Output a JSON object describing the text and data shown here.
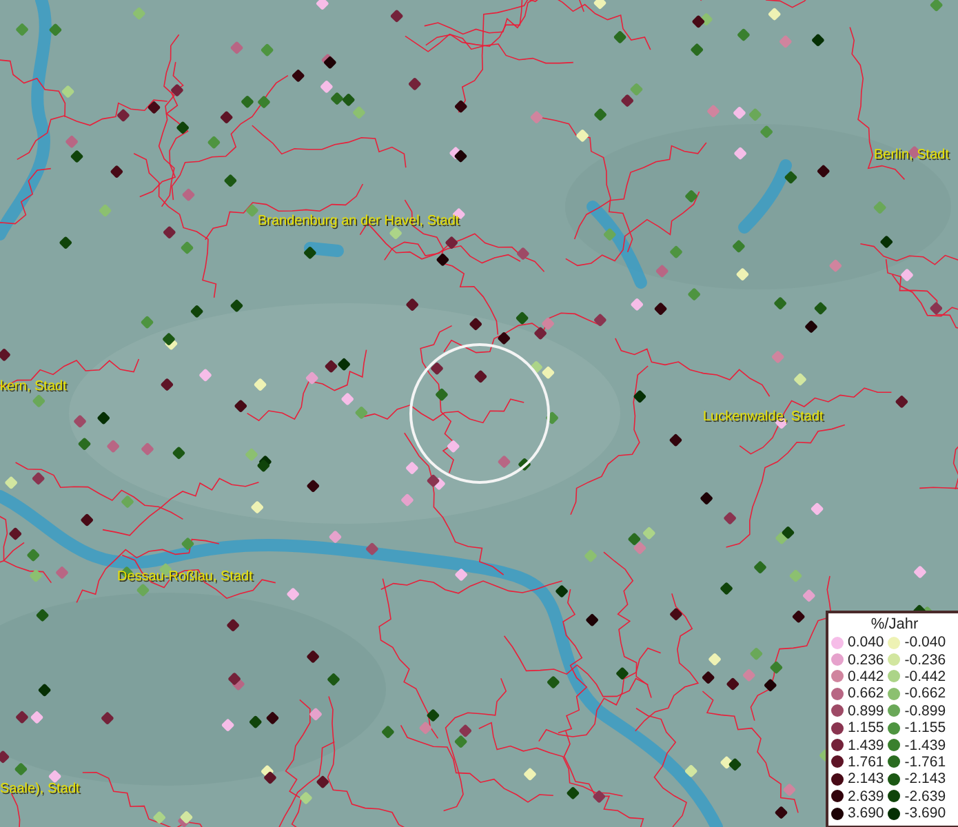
{
  "map": {
    "place_labels": [
      "Berlin, Stadt",
      "Brandenburg an der Havel, Stadt",
      "kern, Stadt",
      "Luckenwalde, Stadt",
      "Dessau-Roßlau, Stadt",
      "Saale), Stadt"
    ]
  },
  "legend": {
    "title": "%/Jahr",
    "positive": [
      {
        "label": "0.040",
        "color": "#f6bde8"
      },
      {
        "label": "0.236",
        "color": "#e6a2cc"
      },
      {
        "label": "0.442",
        "color": "#d0849e"
      },
      {
        "label": "0.662",
        "color": "#b86684"
      },
      {
        "label": "0.899",
        "color": "#9e4a66"
      },
      {
        "label": "1.155",
        "color": "#8a3450"
      },
      {
        "label": "1.439",
        "color": "#74223a"
      },
      {
        "label": "1.761",
        "color": "#5e1426"
      },
      {
        "label": "2.143",
        "color": "#480a16"
      },
      {
        "label": "2.639",
        "color": "#32040c"
      },
      {
        "label": "3.690",
        "color": "#1e0206"
      }
    ],
    "negative": [
      {
        "label": "-0.040",
        "color": "#eef2b4"
      },
      {
        "label": "-0.236",
        "color": "#d2e6a0"
      },
      {
        "label": "-0.442",
        "color": "#acd488"
      },
      {
        "label": "-0.662",
        "color": "#8cc070"
      },
      {
        "label": "-0.899",
        "color": "#6aa858"
      },
      {
        "label": "-1.155",
        "color": "#4e9440"
      },
      {
        "label": "-1.439",
        "color": "#3a802e"
      },
      {
        "label": "-1.761",
        "color": "#2a6c20"
      },
      {
        "label": "-2.143",
        "color": "#1c5814"
      },
      {
        "label": "-2.639",
        "color": "#10440a"
      },
      {
        "label": "-3.690",
        "color": "#063004"
      }
    ]
  }
}
